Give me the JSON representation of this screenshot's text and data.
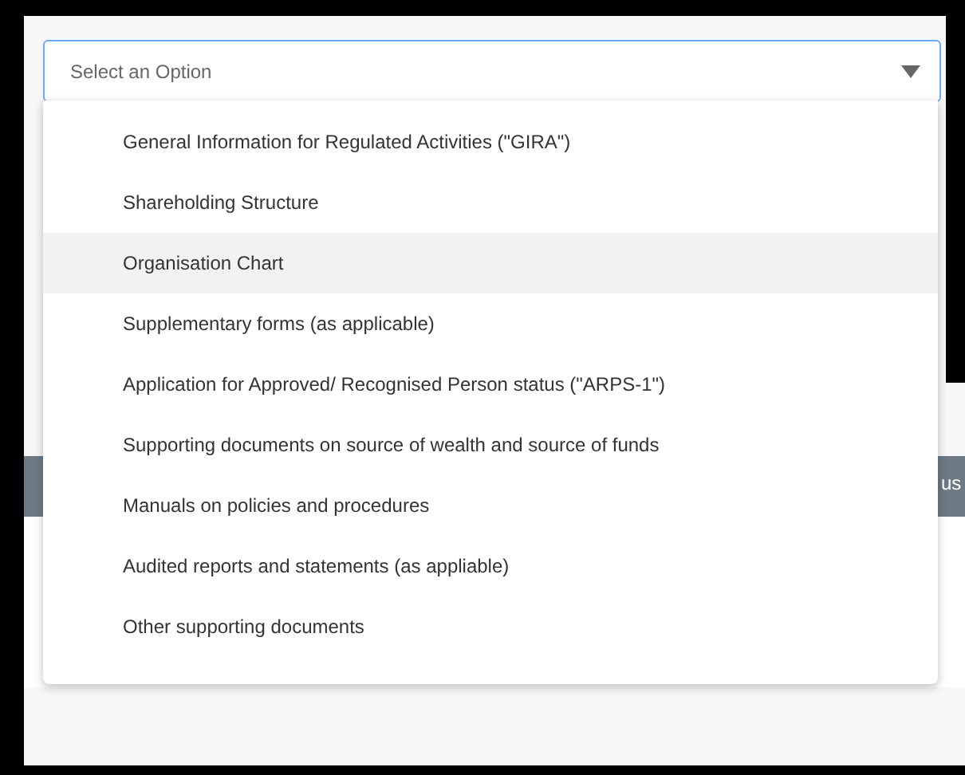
{
  "select": {
    "placeholder": "Select an Option",
    "expanded": true
  },
  "options": [
    {
      "label": "General Information for Regulated Activities (\"GIRA\")",
      "highlighted": false
    },
    {
      "label": "Shareholding Structure",
      "highlighted": false
    },
    {
      "label": "Organisation Chart",
      "highlighted": true
    },
    {
      "label": "Supplementary forms (as applicable)",
      "highlighted": false
    },
    {
      "label": "Application for Approved/ Recognised Person status (\"ARPS-1\")",
      "highlighted": false
    },
    {
      "label": "Supporting documents on source of wealth and source of funds",
      "highlighted": false
    },
    {
      "label": "Manuals on policies and procedures",
      "highlighted": false
    },
    {
      "label": "Audited reports and statements (as appliable)",
      "highlighted": false
    },
    {
      "label": "Other supporting documents",
      "highlighted": false
    }
  ],
  "table_header": {
    "column_fragment": "us"
  }
}
